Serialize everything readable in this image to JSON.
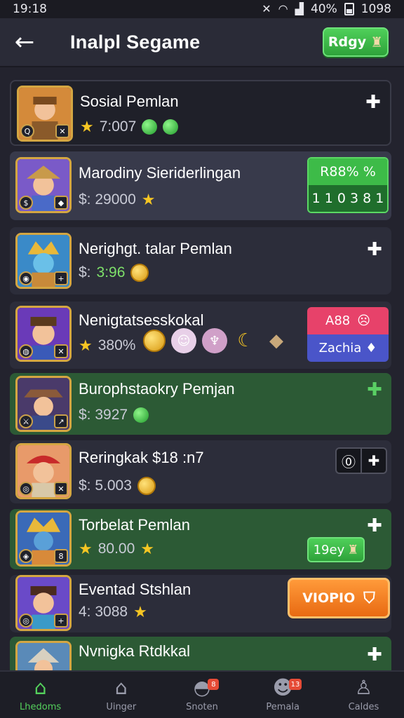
{
  "status_bar": {
    "time": "19:18",
    "battery_text": "40%",
    "clock_right": "1098"
  },
  "app_bar": {
    "title": "Inalpl Segame",
    "ready_label": "Rdgy"
  },
  "rows": [
    {
      "title": "Sosial Pemlan",
      "sub": "7:007"
    },
    {
      "title": "Marodiny Sieriderlingan",
      "sub": "$: 29000",
      "stat_top": "R88% %",
      "stat_bottom": "1 1 0 3 8 1"
    },
    {
      "title": "Nerighgt. talar Pemlan",
      "sub_prefix": "$:",
      "sub_value": "3:96"
    },
    {
      "title": "Nenigtatsesskokal",
      "sub": "380%",
      "box_top": "A88",
      "box_bottom": "Zachia"
    },
    {
      "title": "Burophstaokry Pemjan",
      "sub": "$: 3927"
    },
    {
      "title": "Reringkak $18 :n7",
      "sub": "$: 5.003"
    },
    {
      "title": "Torbelat Pemlan",
      "sub": "80.00",
      "ready_label": "19ey"
    },
    {
      "title": "Eventad Stshlan",
      "sub": "4: 3088",
      "action_label": "VIOPIO"
    },
    {
      "title": "Nvnigka Rtdkkal"
    }
  ],
  "nav": [
    {
      "label": "Lhedoms",
      "active": true
    },
    {
      "label": "Uinger",
      "active": false
    },
    {
      "label": "Snoten",
      "active": false,
      "badge": "8"
    },
    {
      "label": "Pemala",
      "active": false,
      "badge": "13"
    },
    {
      "label": "Caldes",
      "active": false
    }
  ],
  "colors": {
    "background": "#23232e",
    "accent_green": "#3dbb48",
    "orange": "#e86a12",
    "pink": "#e7426a",
    "blue": "#4a55c9"
  }
}
